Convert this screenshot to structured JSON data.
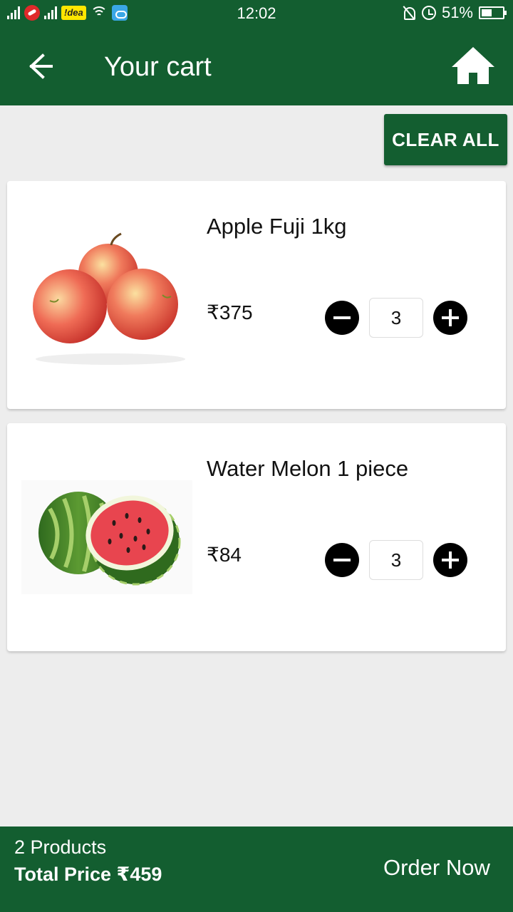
{
  "status_bar": {
    "carrier": "!dea",
    "time": "12:02",
    "battery": "51%",
    "battery_level": 0.51,
    "icons": [
      "signal-icon",
      "carrier-icon",
      "signal-icon",
      "wifi-icon",
      "cloud-icon",
      "mute-bell-icon",
      "alarm-icon",
      "battery-icon"
    ]
  },
  "header": {
    "title": "Your cart",
    "back_icon": "arrow-left-icon",
    "home_icon": "home-icon"
  },
  "actions": {
    "clear_all": "CLEAR ALL"
  },
  "cart": {
    "items": [
      {
        "name": "Apple Fuji 1kg",
        "price": "₹375",
        "quantity": "3",
        "image": "apple-image"
      },
      {
        "name": "Water Melon 1 piece",
        "price": "₹84",
        "quantity": "3",
        "image": "watermelon-image"
      }
    ]
  },
  "footer": {
    "products_count": "2 Products",
    "total_price": "Total Price ₹459",
    "order_now": "Order Now"
  },
  "colors": {
    "primary": "#135e30",
    "background": "#ededed",
    "card": "#ffffff"
  }
}
